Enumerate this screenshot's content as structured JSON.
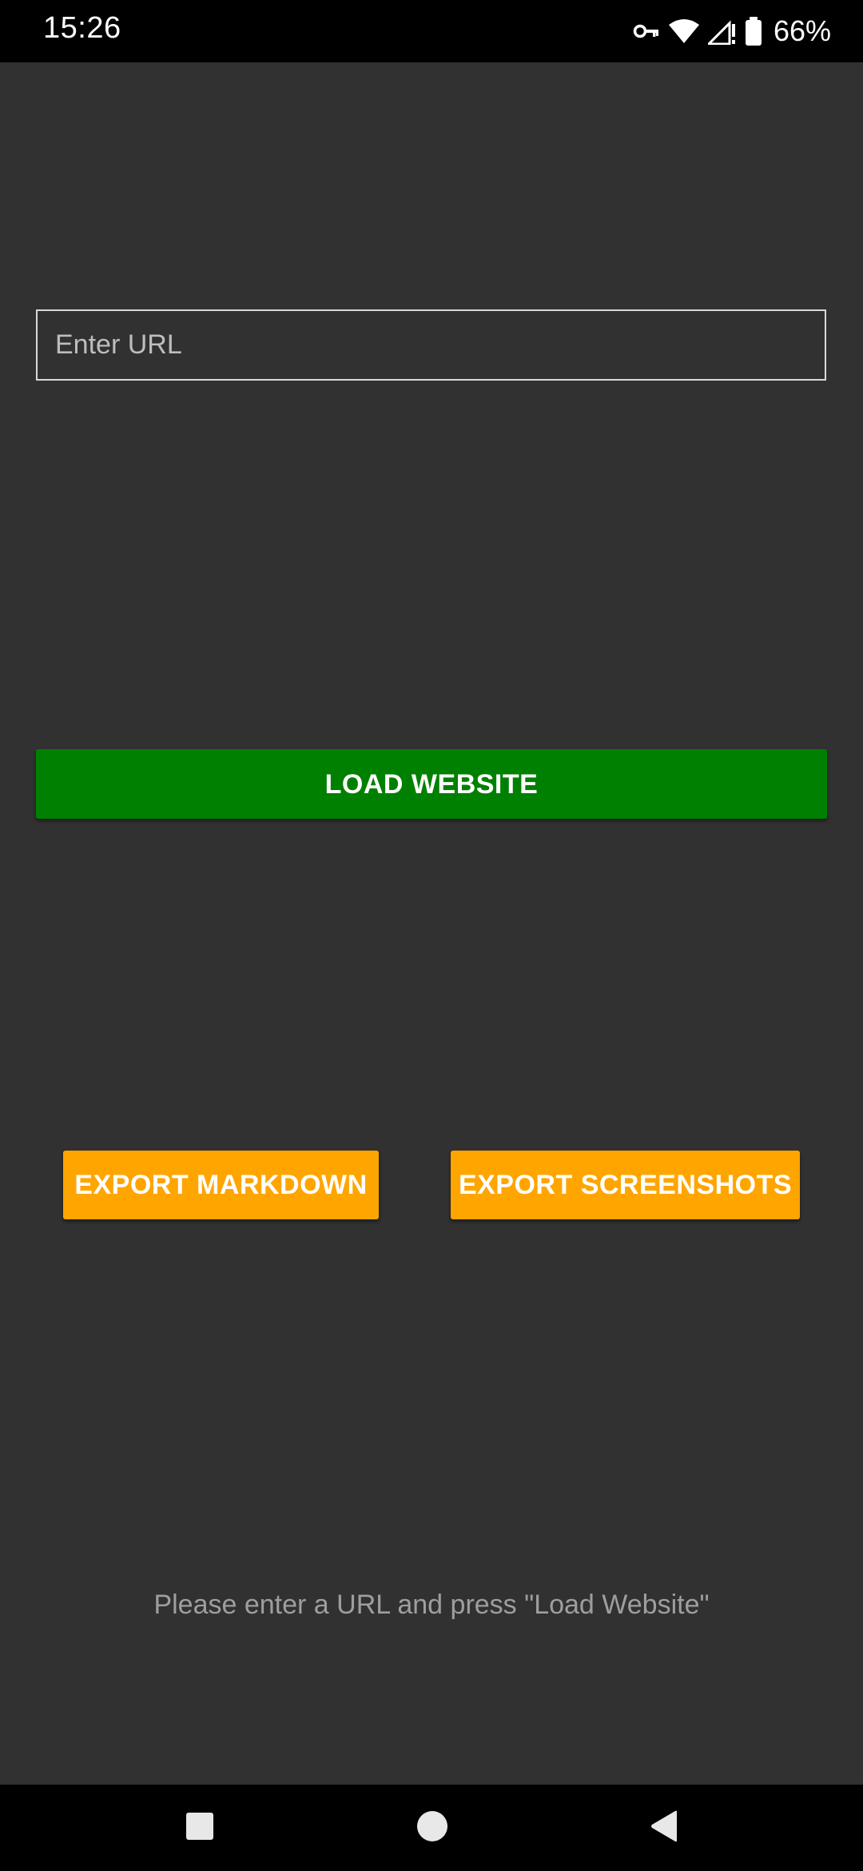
{
  "status_bar": {
    "time": "15:26",
    "battery_percent": "66%",
    "icons": [
      "vpn-key-icon",
      "wifi-icon",
      "cell-signal-icon",
      "battery-icon"
    ]
  },
  "url_input": {
    "placeholder": "Enter URL",
    "value": ""
  },
  "buttons": {
    "load_label": "LOAD WEBSITE",
    "export_markdown_label": "EXPORT MARKDOWN",
    "export_screenshots_label": "EXPORT SCREENSHOTS"
  },
  "message": "Please enter a URL and press \"Load Website\"",
  "colors": {
    "background": "#313131",
    "load_button": "#008000",
    "export_buttons": "#ffa500",
    "bars": "#000000"
  },
  "nav_bar": {
    "icons": [
      "recents-icon",
      "home-icon",
      "back-icon"
    ]
  }
}
